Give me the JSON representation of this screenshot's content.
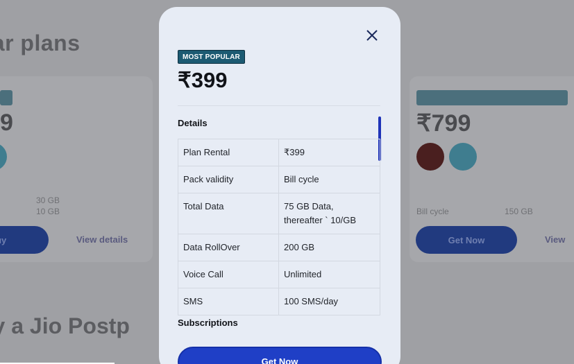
{
  "background": {
    "section_title": "ılar plans",
    "section_title_2": "dy a Jio Postp",
    "left_card": {
      "price": "9",
      "btn_label": "Buy",
      "view_details": "View details",
      "small_1": "30 GB",
      "small_2": "10 GB"
    },
    "right_card": {
      "price": "₹799",
      "btn_label": "Get Now",
      "view_details": "View",
      "small_1": "Bill cycle",
      "small_2": "150 GB"
    }
  },
  "modal": {
    "badge": "MOST POPULAR",
    "price": "₹399",
    "details_heading": "Details",
    "subscriptions_heading": "Subscriptions",
    "cta_label": "Get Now",
    "rows": [
      {
        "label": "Plan Rental",
        "value": "₹399",
        "value2": ""
      },
      {
        "label": "Pack validity",
        "value": "Bill cycle",
        "value2": ""
      },
      {
        "label": "Total Data",
        "value": "75 GB Data,",
        "value2": "thereafter ` 10/GB"
      },
      {
        "label": "Data RollOver",
        "value": "200 GB",
        "value2": ""
      },
      {
        "label": "Voice Call",
        "value": "Unlimited",
        "value2": ""
      },
      {
        "label": "SMS",
        "value": "100 SMS/day",
        "value2": ""
      }
    ]
  },
  "colors": {
    "accent": "#1f3fc6",
    "badge": "#1c5a72",
    "modal_bg": "#e7ecf5"
  }
}
